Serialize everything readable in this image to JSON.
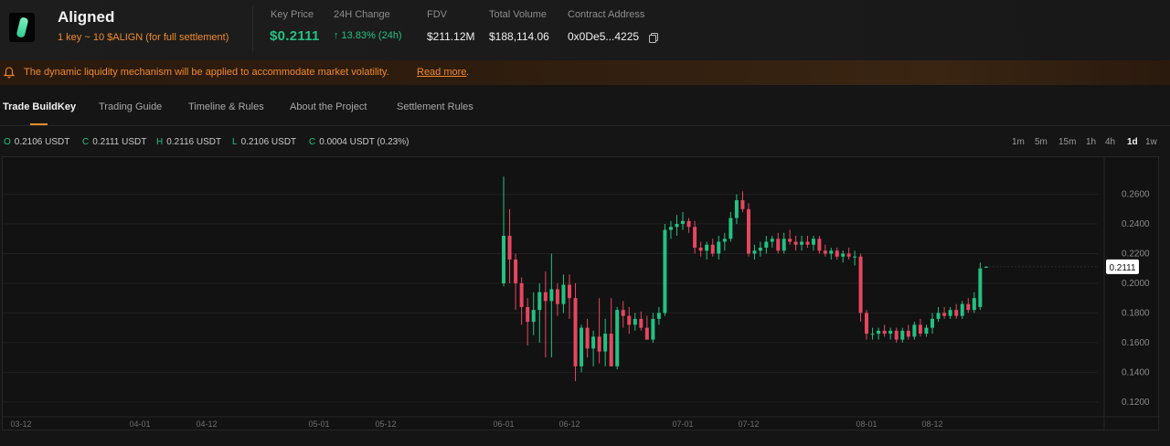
{
  "header": {
    "name": "Aligned",
    "subtitle": "1 key ~ 10 $ALIGN (for full settlement)",
    "stats": {
      "key_price_label": "Key Price",
      "key_price_value": "$0.2111",
      "change_label": "24H Change",
      "change_value": "↑ 13.83% (24h)",
      "fdv_label": "FDV",
      "fdv_value": "$211.12M",
      "volume_label": "Total Volume",
      "volume_value": "$188,114.06",
      "contract_label": "Contract Address",
      "contract_value": "0x0De5...4225"
    }
  },
  "banner": {
    "text": "The dynamic liquidity mechanism will be applied to accommodate market volatility.",
    "link": "Read more",
    "dot": "."
  },
  "tabs": [
    {
      "label": "Trade BuildKey",
      "active": true
    },
    {
      "label": "Trading Guide",
      "active": false
    },
    {
      "label": "Timeline & Rules",
      "active": false
    },
    {
      "label": "About the Project",
      "active": false
    },
    {
      "label": "Settlement Rules",
      "active": false
    }
  ],
  "ohlc": {
    "o_key": "O",
    "o_val": "0.2106 USDT",
    "c_key": "C",
    "c_val": "0.2111 USDT",
    "h_key": "H",
    "h_val": "0.2116 USDT",
    "l_key": "L",
    "l_val": "0.2106 USDT",
    "chg_key": "C",
    "chg_val": "0.0004 USDT (0.23%)"
  },
  "intervals": [
    "1m",
    "5m",
    "15m",
    "1h",
    "4h",
    "1d",
    "1w"
  ],
  "active_interval": "1d",
  "colors": {
    "up": "#23c182",
    "down": "#e5475f",
    "accent": "#f08a2c"
  },
  "icons": {
    "logo": "aligned-logo",
    "copy": "copy-icon",
    "alert": "bell-icon"
  },
  "chart_data": {
    "type": "candlestick",
    "price_tag": "0.2111",
    "y_ticks": [
      "0.2600",
      "0.2400",
      "0.2200",
      "0.2000",
      "0.1800",
      "0.1600",
      "0.1400",
      "0.1200"
    ],
    "x_ticks": [
      "03-12",
      "04-01",
      "04-12",
      "05-01",
      "05-12",
      "06-01",
      "06-12",
      "07-01",
      "07-12",
      "08-01",
      "08-12"
    ],
    "ylim": [
      0.11,
      0.285
    ],
    "series_start": "06-01",
    "candles": [
      {
        "date": "06-01",
        "o": 0.2,
        "h": 0.272,
        "l": 0.198,
        "c": 0.232
      },
      {
        "date": "06-02",
        "o": 0.232,
        "h": 0.25,
        "l": 0.2,
        "c": 0.216
      },
      {
        "date": "06-03",
        "o": 0.216,
        "h": 0.22,
        "l": 0.182,
        "c": 0.2
      },
      {
        "date": "06-04",
        "o": 0.2,
        "h": 0.204,
        "l": 0.172,
        "c": 0.184
      },
      {
        "date": "06-05",
        "o": 0.184,
        "h": 0.19,
        "l": 0.158,
        "c": 0.174
      },
      {
        "date": "06-06",
        "o": 0.174,
        "h": 0.194,
        "l": 0.165,
        "c": 0.182
      },
      {
        "date": "06-07",
        "o": 0.182,
        "h": 0.2,
        "l": 0.16,
        "c": 0.194
      },
      {
        "date": "06-08",
        "o": 0.194,
        "h": 0.208,
        "l": 0.15,
        "c": 0.188
      },
      {
        "date": "06-09",
        "o": 0.188,
        "h": 0.22,
        "l": 0.15,
        "c": 0.196
      },
      {
        "date": "06-10",
        "o": 0.196,
        "h": 0.2,
        "l": 0.178,
        "c": 0.186
      },
      {
        "date": "06-11",
        "o": 0.186,
        "h": 0.206,
        "l": 0.18,
        "c": 0.199
      },
      {
        "date": "06-12",
        "o": 0.199,
        "h": 0.206,
        "l": 0.176,
        "c": 0.19
      },
      {
        "date": "06-13",
        "o": 0.19,
        "h": 0.2,
        "l": 0.134,
        "c": 0.144
      },
      {
        "date": "06-14",
        "o": 0.144,
        "h": 0.172,
        "l": 0.14,
        "c": 0.17
      },
      {
        "date": "06-15",
        "o": 0.17,
        "h": 0.176,
        "l": 0.15,
        "c": 0.156
      },
      {
        "date": "06-16",
        "o": 0.156,
        "h": 0.168,
        "l": 0.144,
        "c": 0.164
      },
      {
        "date": "06-17",
        "o": 0.164,
        "h": 0.19,
        "l": 0.146,
        "c": 0.154
      },
      {
        "date": "06-18",
        "o": 0.154,
        "h": 0.176,
        "l": 0.144,
        "c": 0.166
      },
      {
        "date": "06-19",
        "o": 0.166,
        "h": 0.19,
        "l": 0.144,
        "c": 0.144
      },
      {
        "date": "06-20",
        "o": 0.144,
        "h": 0.184,
        "l": 0.142,
        "c": 0.182
      },
      {
        "date": "06-21",
        "o": 0.182,
        "h": 0.188,
        "l": 0.17,
        "c": 0.178
      },
      {
        "date": "06-22",
        "o": 0.178,
        "h": 0.184,
        "l": 0.166,
        "c": 0.172
      },
      {
        "date": "06-23",
        "o": 0.172,
        "h": 0.18,
        "l": 0.168,
        "c": 0.176
      },
      {
        "date": "06-24",
        "o": 0.176,
        "h": 0.181,
        "l": 0.168,
        "c": 0.17
      },
      {
        "date": "06-25",
        "o": 0.17,
        "h": 0.178,
        "l": 0.162,
        "c": 0.162
      },
      {
        "date": "06-26",
        "o": 0.162,
        "h": 0.18,
        "l": 0.16,
        "c": 0.176
      },
      {
        "date": "06-27",
        "o": 0.176,
        "h": 0.184,
        "l": 0.172,
        "c": 0.18
      },
      {
        "date": "06-28",
        "o": 0.18,
        "h": 0.24,
        "l": 0.178,
        "c": 0.236
      },
      {
        "date": "06-29",
        "o": 0.236,
        "h": 0.242,
        "l": 0.23,
        "c": 0.238
      },
      {
        "date": "06-30",
        "o": 0.238,
        "h": 0.246,
        "l": 0.232,
        "c": 0.24
      },
      {
        "date": "07-01",
        "o": 0.24,
        "h": 0.248,
        "l": 0.236,
        "c": 0.242
      },
      {
        "date": "07-02",
        "o": 0.242,
        "h": 0.244,
        "l": 0.234,
        "c": 0.238
      },
      {
        "date": "07-03",
        "o": 0.238,
        "h": 0.242,
        "l": 0.22,
        "c": 0.224
      },
      {
        "date": "07-04",
        "o": 0.224,
        "h": 0.228,
        "l": 0.218,
        "c": 0.222
      },
      {
        "date": "07-05",
        "o": 0.222,
        "h": 0.228,
        "l": 0.216,
        "c": 0.226
      },
      {
        "date": "07-06",
        "o": 0.226,
        "h": 0.23,
        "l": 0.218,
        "c": 0.22
      },
      {
        "date": "07-07",
        "o": 0.22,
        "h": 0.232,
        "l": 0.216,
        "c": 0.228
      },
      {
        "date": "07-08",
        "o": 0.228,
        "h": 0.234,
        "l": 0.222,
        "c": 0.23
      },
      {
        "date": "07-09",
        "o": 0.23,
        "h": 0.248,
        "l": 0.228,
        "c": 0.244
      },
      {
        "date": "07-10",
        "o": 0.244,
        "h": 0.26,
        "l": 0.24,
        "c": 0.256
      },
      {
        "date": "07-11",
        "o": 0.256,
        "h": 0.262,
        "l": 0.248,
        "c": 0.25
      },
      {
        "date": "07-12",
        "o": 0.25,
        "h": 0.254,
        "l": 0.218,
        "c": 0.22
      },
      {
        "date": "07-13",
        "o": 0.22,
        "h": 0.226,
        "l": 0.216,
        "c": 0.222
      },
      {
        "date": "07-14",
        "o": 0.222,
        "h": 0.228,
        "l": 0.218,
        "c": 0.224
      },
      {
        "date": "07-15",
        "o": 0.224,
        "h": 0.232,
        "l": 0.22,
        "c": 0.228
      },
      {
        "date": "07-16",
        "o": 0.228,
        "h": 0.232,
        "l": 0.224,
        "c": 0.23
      },
      {
        "date": "07-17",
        "o": 0.23,
        "h": 0.234,
        "l": 0.22,
        "c": 0.222
      },
      {
        "date": "07-18",
        "o": 0.222,
        "h": 0.234,
        "l": 0.22,
        "c": 0.23
      },
      {
        "date": "07-19",
        "o": 0.23,
        "h": 0.236,
        "l": 0.226,
        "c": 0.228
      },
      {
        "date": "07-20",
        "o": 0.228,
        "h": 0.232,
        "l": 0.222,
        "c": 0.226
      },
      {
        "date": "07-21",
        "o": 0.226,
        "h": 0.232,
        "l": 0.222,
        "c": 0.228
      },
      {
        "date": "07-22",
        "o": 0.228,
        "h": 0.232,
        "l": 0.224,
        "c": 0.226
      },
      {
        "date": "07-23",
        "o": 0.226,
        "h": 0.232,
        "l": 0.222,
        "c": 0.23
      },
      {
        "date": "07-24",
        "o": 0.23,
        "h": 0.232,
        "l": 0.22,
        "c": 0.222
      },
      {
        "date": "07-25",
        "o": 0.222,
        "h": 0.226,
        "l": 0.218,
        "c": 0.22
      },
      {
        "date": "07-26",
        "o": 0.22,
        "h": 0.224,
        "l": 0.216,
        "c": 0.222
      },
      {
        "date": "07-27",
        "o": 0.222,
        "h": 0.224,
        "l": 0.216,
        "c": 0.218
      },
      {
        "date": "07-28",
        "o": 0.218,
        "h": 0.222,
        "l": 0.214,
        "c": 0.22
      },
      {
        "date": "07-29",
        "o": 0.22,
        "h": 0.224,
        "l": 0.216,
        "c": 0.218
      },
      {
        "date": "07-30",
        "o": 0.218,
        "h": 0.222,
        "l": 0.212,
        "c": 0.218
      },
      {
        "date": "07-31",
        "o": 0.218,
        "h": 0.22,
        "l": 0.174,
        "c": 0.18
      },
      {
        "date": "08-01",
        "o": 0.18,
        "h": 0.182,
        "l": 0.162,
        "c": 0.166
      },
      {
        "date": "08-02",
        "o": 0.166,
        "h": 0.17,
        "l": 0.162,
        "c": 0.166
      },
      {
        "date": "08-03",
        "o": 0.166,
        "h": 0.17,
        "l": 0.162,
        "c": 0.168
      },
      {
        "date": "08-04",
        "o": 0.168,
        "h": 0.172,
        "l": 0.164,
        "c": 0.166
      },
      {
        "date": "08-05",
        "o": 0.166,
        "h": 0.17,
        "l": 0.162,
        "c": 0.168
      },
      {
        "date": "08-06",
        "o": 0.168,
        "h": 0.17,
        "l": 0.16,
        "c": 0.162
      },
      {
        "date": "08-07",
        "o": 0.162,
        "h": 0.17,
        "l": 0.16,
        "c": 0.168
      },
      {
        "date": "08-08",
        "o": 0.168,
        "h": 0.172,
        "l": 0.162,
        "c": 0.164
      },
      {
        "date": "08-09",
        "o": 0.164,
        "h": 0.174,
        "l": 0.162,
        "c": 0.172
      },
      {
        "date": "08-10",
        "o": 0.172,
        "h": 0.176,
        "l": 0.164,
        "c": 0.166
      },
      {
        "date": "08-11",
        "o": 0.166,
        "h": 0.172,
        "l": 0.164,
        "c": 0.17
      },
      {
        "date": "08-12",
        "o": 0.17,
        "h": 0.18,
        "l": 0.166,
        "c": 0.176
      },
      {
        "date": "08-13",
        "o": 0.176,
        "h": 0.184,
        "l": 0.174,
        "c": 0.18
      },
      {
        "date": "08-14",
        "o": 0.18,
        "h": 0.184,
        "l": 0.176,
        "c": 0.178
      },
      {
        "date": "08-15",
        "o": 0.178,
        "h": 0.184,
        "l": 0.176,
        "c": 0.182
      },
      {
        "date": "08-16",
        "o": 0.182,
        "h": 0.186,
        "l": 0.176,
        "c": 0.178
      },
      {
        "date": "08-17",
        "o": 0.178,
        "h": 0.188,
        "l": 0.176,
        "c": 0.186
      },
      {
        "date": "08-18",
        "o": 0.186,
        "h": 0.19,
        "l": 0.18,
        "c": 0.182
      },
      {
        "date": "08-19",
        "o": 0.182,
        "h": 0.194,
        "l": 0.18,
        "c": 0.19
      },
      {
        "date": "08-20",
        "o": 0.184,
        "h": 0.214,
        "l": 0.182,
        "c": 0.21
      },
      {
        "date": "08-21",
        "o": 0.2106,
        "h": 0.2116,
        "l": 0.2106,
        "c": 0.2111
      }
    ]
  }
}
